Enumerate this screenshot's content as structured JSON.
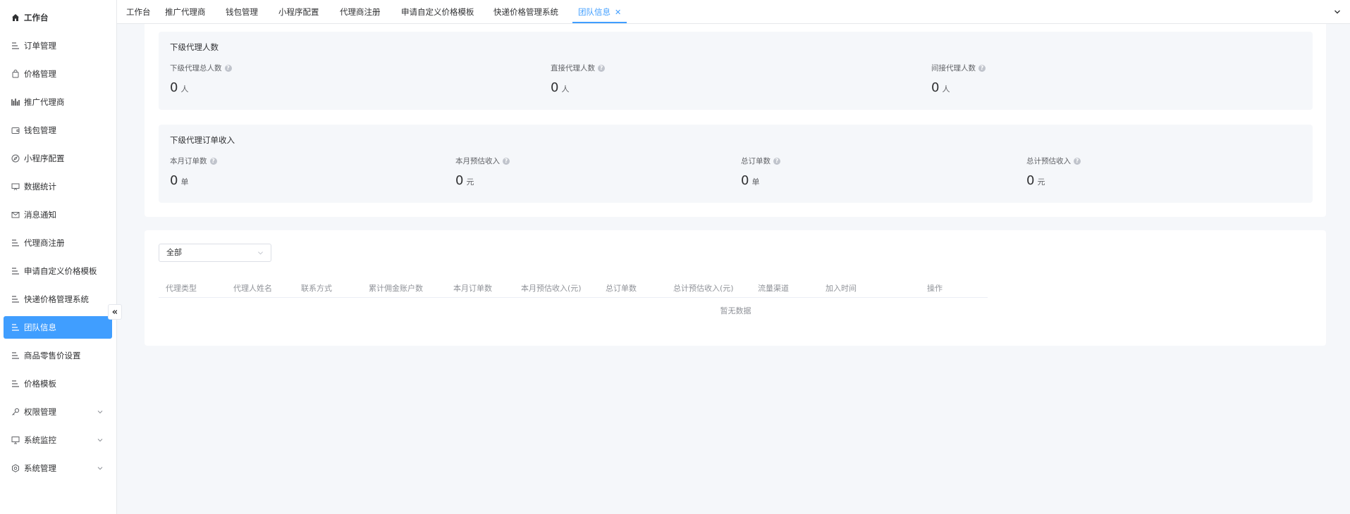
{
  "sidebar": {
    "items": [
      {
        "label": "工作台",
        "icon": "home-icon"
      },
      {
        "label": "订单管理",
        "icon": "list-icon"
      },
      {
        "label": "价格管理",
        "icon": "bag-icon"
      },
      {
        "label": "推广代理商",
        "icon": "chart-icon"
      },
      {
        "label": "钱包管理",
        "icon": "wallet-icon"
      },
      {
        "label": "小程序配置",
        "icon": "compass-icon"
      },
      {
        "label": "数据统计",
        "icon": "monitor-icon"
      },
      {
        "label": "消息通知",
        "icon": "mail-icon"
      },
      {
        "label": "代理商注册",
        "icon": "list-icon"
      },
      {
        "label": "申请自定义价格模板",
        "icon": "list-icon"
      },
      {
        "label": "快递价格管理系统",
        "icon": "list-icon"
      },
      {
        "label": "团队信息",
        "icon": "list-icon",
        "active": true
      },
      {
        "label": "商品零售价设置",
        "icon": "list-icon"
      },
      {
        "label": "价格模板",
        "icon": "list-icon"
      },
      {
        "label": "权限管理",
        "icon": "key-icon",
        "expandable": true
      },
      {
        "label": "系统监控",
        "icon": "screen-icon",
        "expandable": true
      },
      {
        "label": "系统管理",
        "icon": "settings-icon",
        "expandable": true
      }
    ],
    "collapse_symbol": "«"
  },
  "tabs": [
    {
      "label": "工作台"
    },
    {
      "label": "推广代理商"
    },
    {
      "label": "钱包管理"
    },
    {
      "label": "小程序配置"
    },
    {
      "label": "代理商注册"
    },
    {
      "label": "申请自定义价格模板"
    },
    {
      "label": "快递价格管理系统"
    },
    {
      "label": "团队信息",
      "active": true
    }
  ],
  "agents_panel": {
    "title": "下级代理人数",
    "stats": [
      {
        "label": "下级代理总人数",
        "value": "0",
        "unit": "人"
      },
      {
        "label": "直接代理人数",
        "value": "0",
        "unit": "人"
      },
      {
        "label": "间接代理人数",
        "value": "0",
        "unit": "人"
      }
    ]
  },
  "income_panel": {
    "title": "下级代理订单收入",
    "stats": [
      {
        "label": "本月订单数",
        "value": "0",
        "unit": "单"
      },
      {
        "label": "本月预估收入",
        "value": "0",
        "unit": "元"
      },
      {
        "label": "总订单数",
        "value": "0",
        "unit": "单"
      },
      {
        "label": "总计预估收入",
        "value": "0",
        "unit": "元"
      }
    ]
  },
  "filter": {
    "selected": "全部"
  },
  "table": {
    "columns": [
      "代理类型",
      "代理人姓名",
      "联系方式",
      "累计佣金账户数",
      "本月订单数",
      "本月预估收入(元)",
      "总订单数",
      "总计预估收入(元)",
      "流量渠道",
      "加入时间",
      "操作"
    ],
    "empty_text": "暂无数据"
  },
  "colors": {
    "accent": "#409eff",
    "background": "#f5f7fa"
  }
}
